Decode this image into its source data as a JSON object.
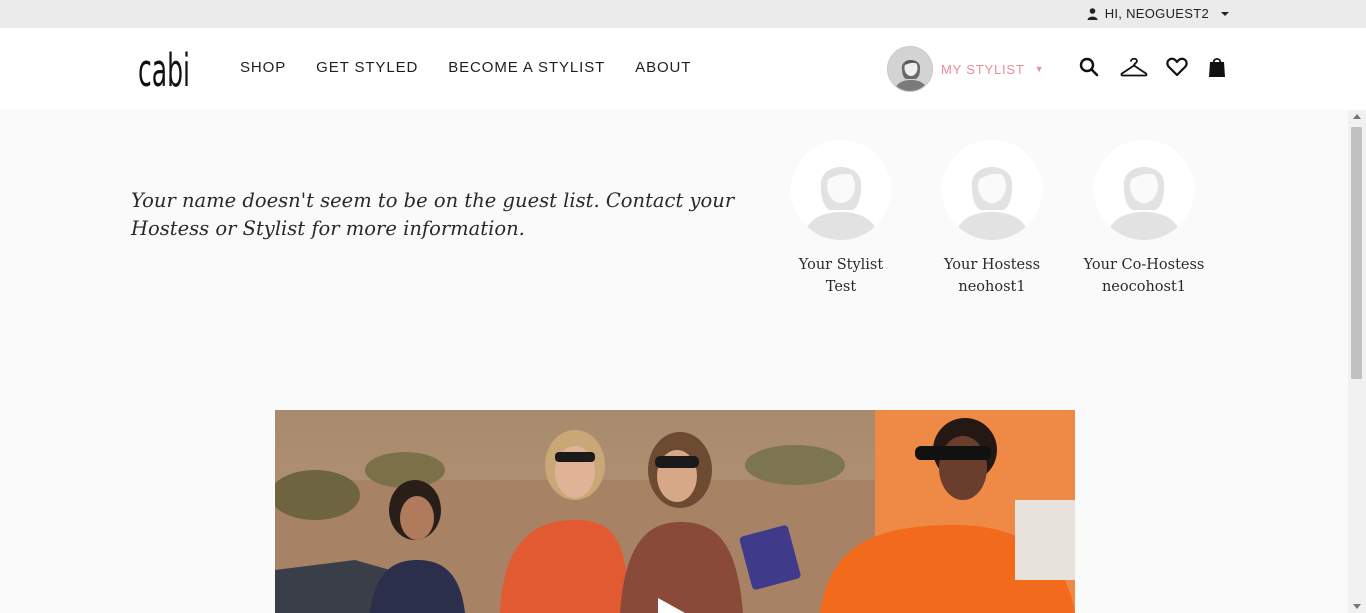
{
  "topbar": {
    "greeting": "HI, NEOGUEST2",
    "user_icon": "user-icon",
    "caret_icon": "caret-down-icon"
  },
  "header": {
    "logo_text": "cabi",
    "nav": [
      {
        "label": "SHOP"
      },
      {
        "label": "GET STYLED"
      },
      {
        "label": "BECOME A STYLIST"
      },
      {
        "label": "ABOUT"
      }
    ],
    "my_stylist_label": "MY STYLIST",
    "icons": [
      "search-icon",
      "hanger-icon",
      "heart-icon",
      "shopping-bag-icon"
    ],
    "accent_color": "#f08a96"
  },
  "main": {
    "message": "Your name doesn't seem to be on the guest list. Contact your Hostess or Stylist for more information.",
    "hosts": [
      {
        "role": "Your Stylist",
        "name": "Test"
      },
      {
        "role": "Your Hostess",
        "name": "neohost1"
      },
      {
        "role": "Your Co-Hostess",
        "name": "neocohost1"
      }
    ],
    "video": {
      "play_icon": "play-icon"
    }
  }
}
